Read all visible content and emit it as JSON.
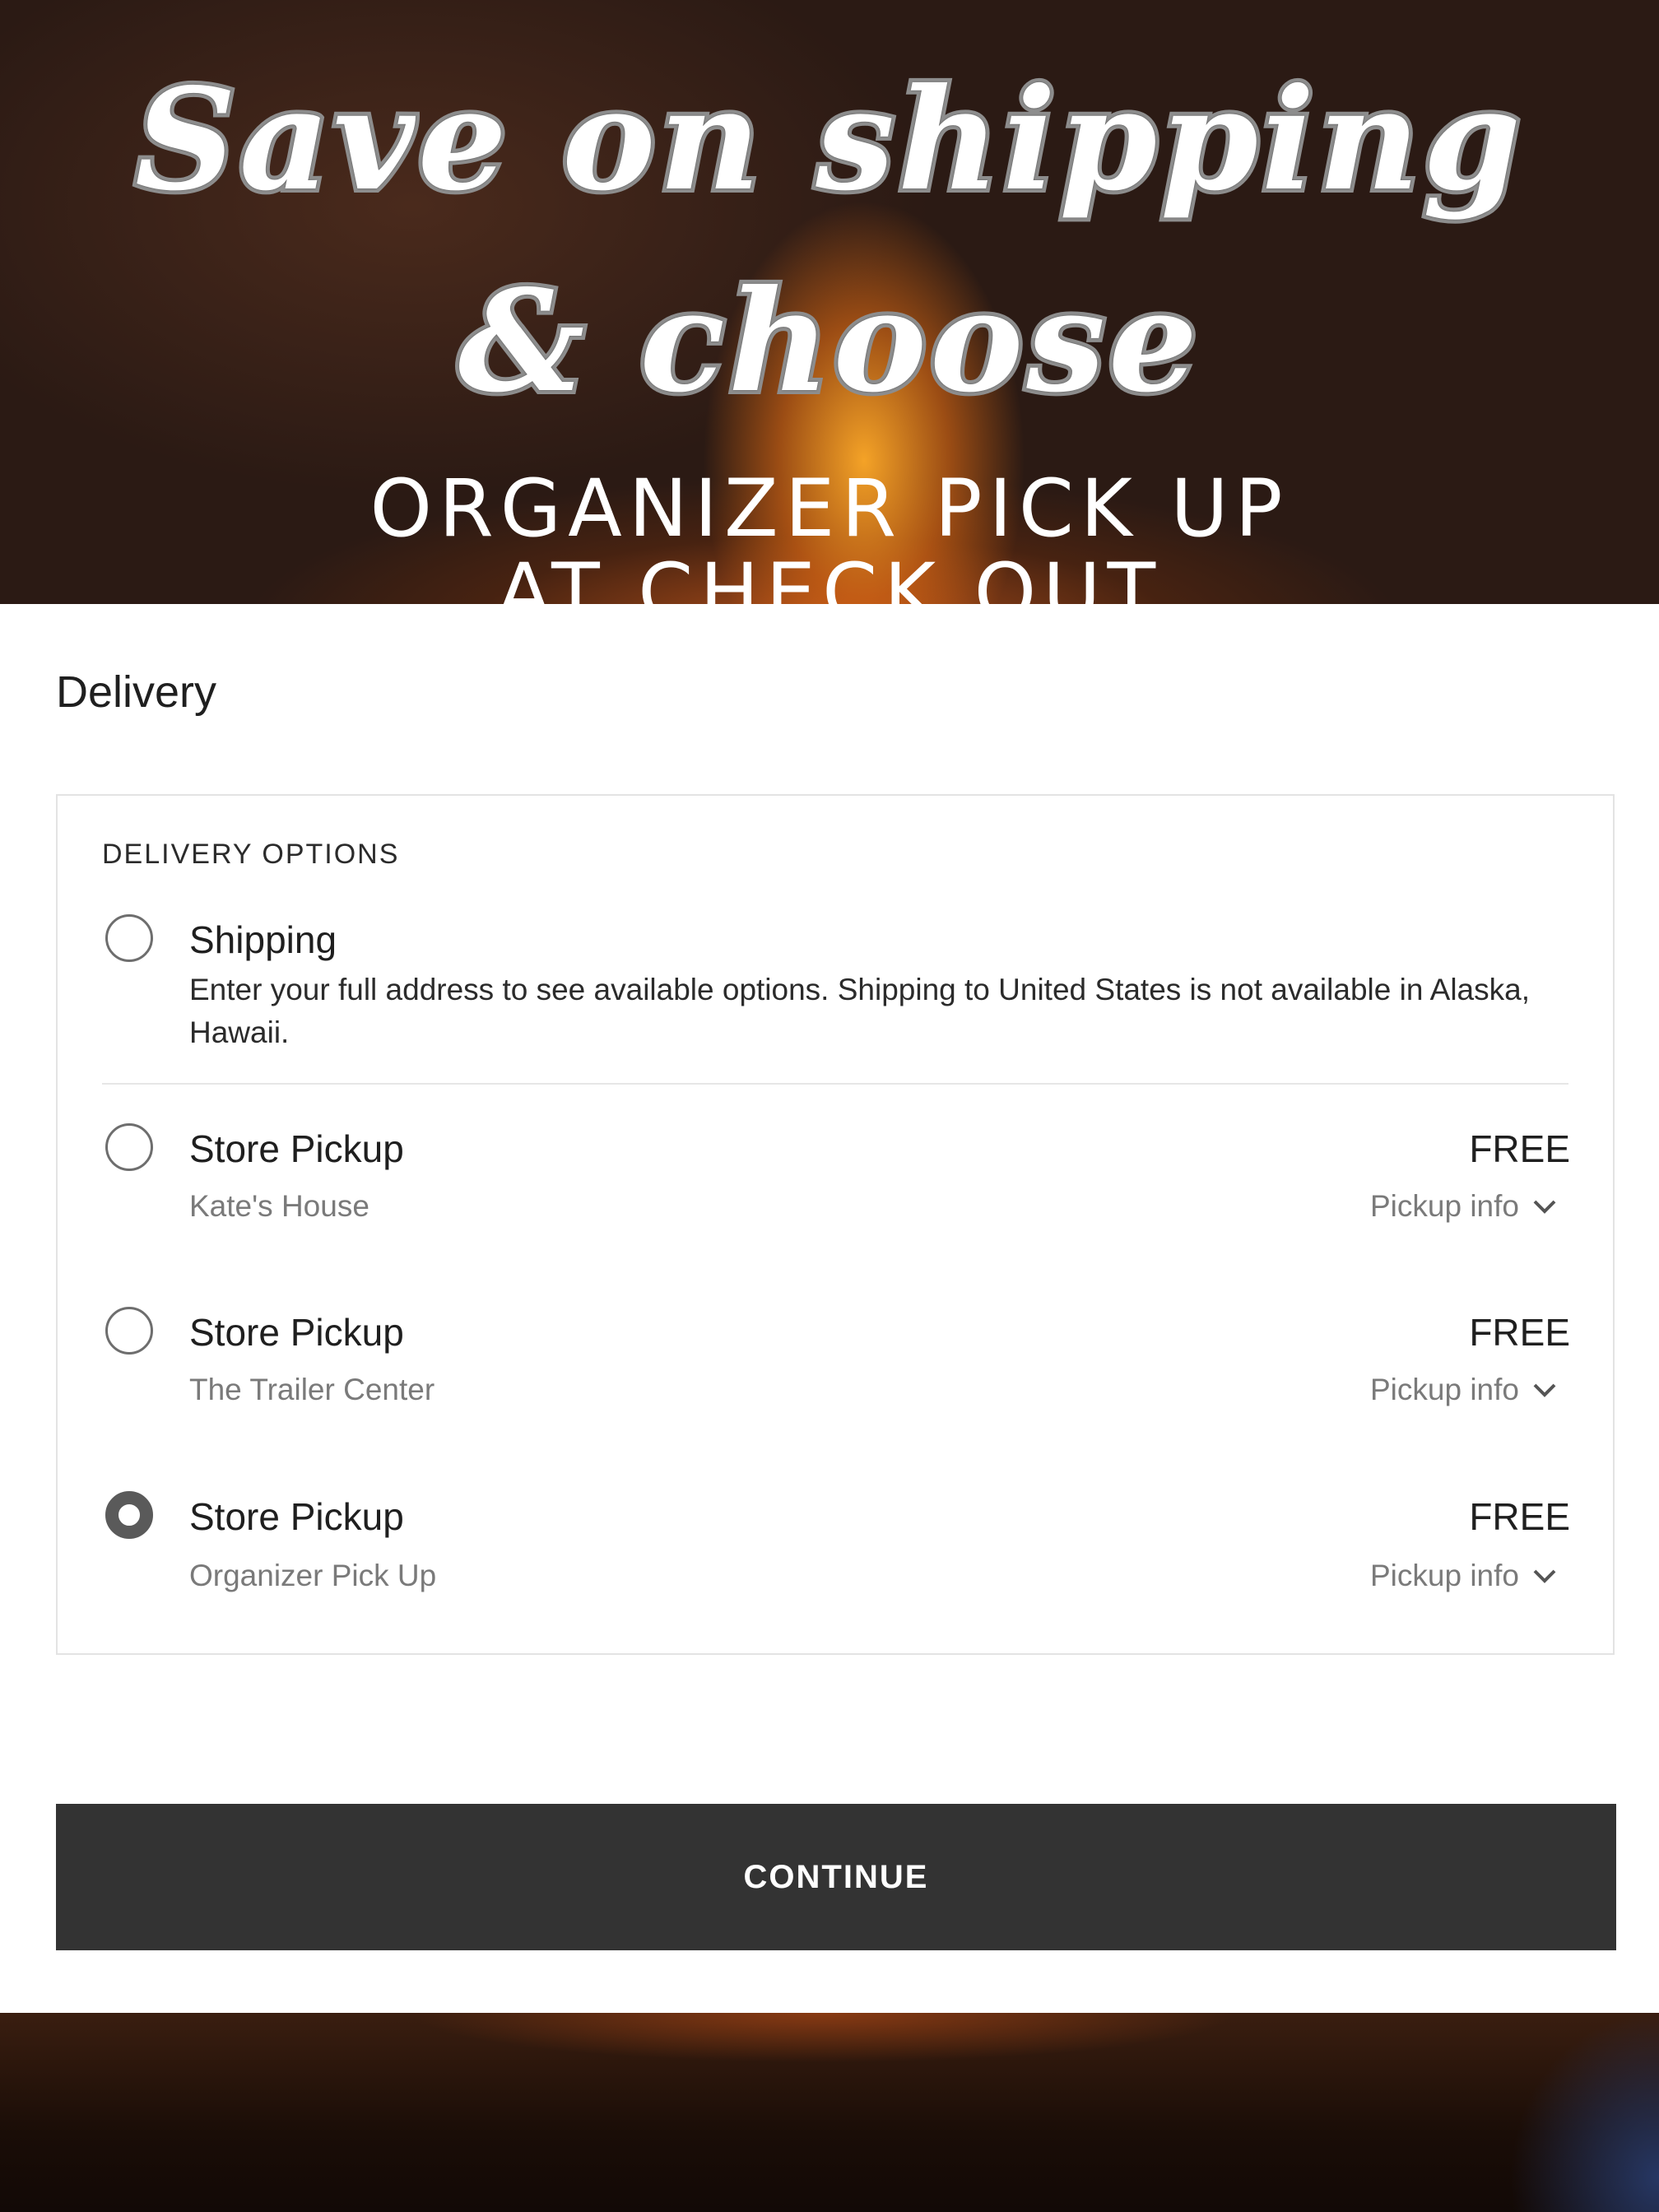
{
  "hero": {
    "script_line1": "Save on shipping",
    "script_line2": "& choose",
    "caps_line1": "ORGANIZER PICK UP",
    "caps_line2": "AT CHECK OUT"
  },
  "delivery": {
    "title": "Delivery",
    "options_heading": "DELIVERY OPTIONS",
    "shipping": {
      "label": "Shipping",
      "description": "Enter your full address to see available options. Shipping to United States is not available in Alaska, Hawaii.",
      "selected": false
    },
    "pickups": [
      {
        "label": "Store Pickup",
        "location": "Kate's House",
        "price": "FREE",
        "info_label": "Pickup info",
        "selected": false
      },
      {
        "label": "Store Pickup",
        "location": "The Trailer Center",
        "price": "FREE",
        "info_label": "Pickup info",
        "selected": false
      },
      {
        "label": "Store Pickup",
        "location": "Organizer Pick Up",
        "price": "FREE",
        "info_label": "Pickup info",
        "selected": true
      }
    ]
  },
  "continue_button": {
    "label": "CONTINUE"
  },
  "icons": {
    "expand": "chevron-down-icon"
  },
  "colors": {
    "button_bg": "#333333",
    "radio_selected": "#5a5a5a",
    "muted_text": "#7a7a7a"
  }
}
